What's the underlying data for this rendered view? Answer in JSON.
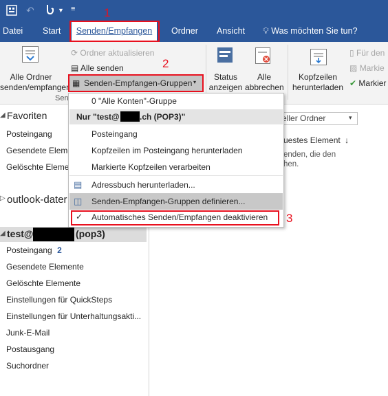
{
  "tabs": {
    "datei": "Datei",
    "start": "Start",
    "senden": "Senden/Empfangen",
    "ordner": "Ordner",
    "ansicht": "Ansicht",
    "search": "Was möchten Sie tun?"
  },
  "ribbon": {
    "alle_ordner_1": "Alle Ordner",
    "alle_ordner_2": "senden/empfangen",
    "ordner_aktualisieren": "Ordner aktualisieren",
    "alle_senden": "Alle senden",
    "gruppen_button": "Senden-Empfangen-Gruppen",
    "group_label": "Send",
    "status_1": "Status",
    "status_2": "anzeigen",
    "abbrechen_1": "Alle",
    "abbrechen_2": "abbrechen",
    "kopfzeilen_1": "Kopfzeilen",
    "kopfzeilen_2": "herunterladen",
    "fuer_den": "Für den",
    "markier_1": "Markie",
    "markier_2": "Markier"
  },
  "nav": {
    "favoriten": "Favoriten",
    "fav_items": [
      "Posteingang",
      "Gesendete Eleme",
      "Gelöschte Elemen"
    ],
    "outlook_data": "outlook-dater",
    "account_prefix": "test@",
    "account_suffix": "(pop3)",
    "posteingang": "Posteingang",
    "posteingang_count": "2",
    "items": [
      "Gesendete Elemente",
      "Gelöschte Elemente",
      "Einstellungen für QuickSteps",
      "Einstellungen für Unterhaltungsakti...",
      "Junk-E-Mail",
      "Postausgang",
      "Suchordner"
    ]
  },
  "rightpane": {
    "aktueller_ordner": "Aktueller Ordner",
    "neuestes": "uestes Element",
    "text_1": "enden, die den",
    "text_2": "hen."
  },
  "menu": {
    "alle_konten": "0 \"Alle Konten\"-Gruppe",
    "nur_header_prefix": "Nur \"test@",
    "nur_header_suffix": ".ch (POP3)\"",
    "posteingang": "Posteingang",
    "kopfzeilen_posteingang": "Kopfzeilen im Posteingang herunterladen",
    "markierte": "Markierte Kopfzeilen verarbeiten",
    "adressbuch": "Adressbuch herunterladen...",
    "definieren": "Senden-Empfangen-Gruppen definieren...",
    "deaktivieren": "Automatisches Senden/Empfangen deaktivieren"
  },
  "annotations": {
    "n1": "1",
    "n2": "2",
    "n3": "3"
  }
}
